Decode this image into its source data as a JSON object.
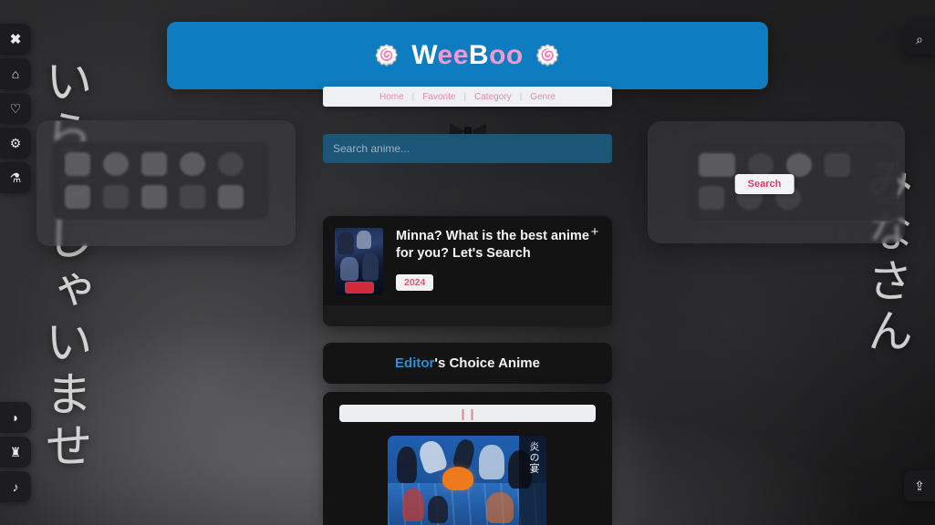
{
  "site": {
    "logo_swirl_left": "🍥",
    "logo_swirl_right": "🍥",
    "logo_part_1": "W",
    "logo_part_2": "ee",
    "logo_part_3": "B",
    "logo_part_4": "oo",
    "header_color": "#0d7cc0",
    "accent_pink": "#f09ad0"
  },
  "nav": {
    "separator": "|",
    "items": [
      {
        "label": "Home"
      },
      {
        "label": "Favorite"
      },
      {
        "label": "Category"
      },
      {
        "label": "Genre"
      }
    ]
  },
  "search": {
    "value": "",
    "placeholder": "Search anime...",
    "button_label": "Search",
    "button_text_color": "#dc3f63",
    "field_color": "#1b5577"
  },
  "promo": {
    "title": "Minna? What is the best anime for you? Let's Search",
    "year_badge": "2024",
    "add_icon": "+",
    "poster_alt": "detective-conan-poster"
  },
  "editors": {
    "accent_word": "Editor",
    "rest": "'s Choice Anime",
    "accent_color": "#2a8fd4"
  },
  "carousel": {
    "bar_glyph": "❙❙",
    "poster_alt": "haikyuu-poster",
    "poster_band_text": "炎の宴"
  },
  "decor": {
    "left_text": "いらっしゃいませ",
    "right_text": "みなさん"
  },
  "rails": {
    "left_top": [
      {
        "name": "close-icon",
        "glyph": "✖"
      },
      {
        "name": "home-icon",
        "glyph": "⌂"
      },
      {
        "name": "heart-icon",
        "glyph": "♡"
      },
      {
        "name": "gear-icon",
        "glyph": "⚙"
      },
      {
        "name": "sliders-icon",
        "glyph": "⚗"
      }
    ],
    "left_bottom": [
      {
        "name": "moon-icon",
        "glyph": "◗"
      },
      {
        "name": "cinema-icon",
        "glyph": "♜"
      },
      {
        "name": "music-note-icon",
        "glyph": "♪"
      }
    ],
    "right_top": [
      {
        "name": "search-icon",
        "glyph": "⌕"
      }
    ],
    "right_bottom": [
      {
        "name": "scroll-to-top-icon",
        "glyph": "⇪"
      }
    ]
  }
}
